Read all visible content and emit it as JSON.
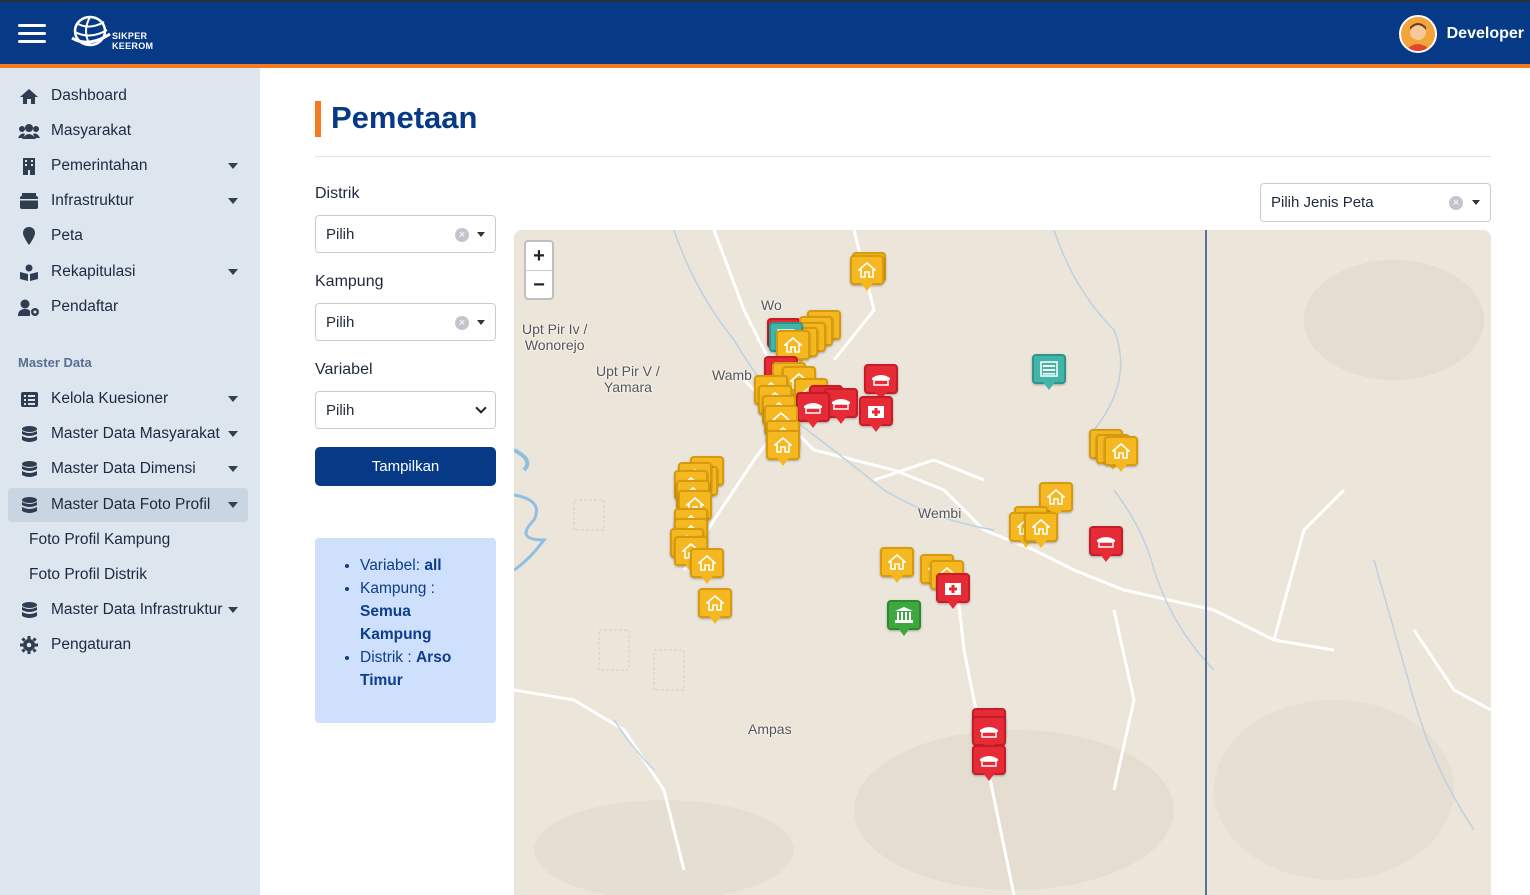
{
  "header": {
    "logo_text_1": "SIKPER",
    "logo_text_2": "KEEROM",
    "user_name": "Developer"
  },
  "sidebar": {
    "items": [
      {
        "label": "Dashboard",
        "icon": "home-icon"
      },
      {
        "label": "Masyarakat",
        "icon": "users-icon"
      },
      {
        "label": "Pemerintahan",
        "icon": "building-icon",
        "has_caret": true
      },
      {
        "label": "Infrastruktur",
        "icon": "box-icon",
        "has_caret": true
      },
      {
        "label": "Peta",
        "icon": "map-marker-icon"
      },
      {
        "label": "Rekapitulasi",
        "icon": "book-reader-icon",
        "has_caret": true
      },
      {
        "label": "Pendaftar",
        "icon": "user-cog-icon"
      }
    ],
    "section_title": "Master Data",
    "master_items": [
      {
        "label": "Kelola Kuesioner",
        "icon": "list-icon",
        "has_caret": true
      },
      {
        "label": "Master Data Masyarakat",
        "icon": "database-icon",
        "has_caret": true
      },
      {
        "label": "Master Data Dimensi",
        "icon": "database-icon",
        "has_caret": true
      },
      {
        "label": "Master Data Foto Profil",
        "icon": "database-icon",
        "has_caret": true,
        "active": true
      },
      {
        "label": "Master Data Infrastruktur",
        "icon": "database-icon",
        "has_caret": true
      },
      {
        "label": "Pengaturan",
        "icon": "gear-icon"
      }
    ],
    "sub_items": [
      "Foto Profil Kampung",
      "Foto Profil Distrik"
    ]
  },
  "main": {
    "title": "Pemetaan",
    "filters": {
      "distrik_label": "Distrik",
      "distrik_value": "Pilih",
      "kampung_label": "Kampung",
      "kampung_value": "Pilih",
      "variabel_label": "Variabel",
      "variabel_value": "Pilih",
      "submit_label": "Tampilkan"
    },
    "map_type_placeholder": "Pilih Jenis Peta",
    "info": {
      "variabel_label": "Variabel:",
      "variabel_value": "all",
      "kampung_label": "Kampung :",
      "kampung_value": "Semua Kampung",
      "distrik_label": "Distrik :",
      "distrik_value": "Arso Timur"
    }
  },
  "map": {
    "zoom_in": "+",
    "zoom_out": "−",
    "places": {
      "p1_a": "Upt Pir Iv /",
      "p1_b": "Wonorejo",
      "p2_a": "Upt Pir V /",
      "p2_b": "Yamara",
      "p3": "Wamb",
      "p4": "Wo",
      "p5": "Wembi",
      "p6": "Ampas"
    },
    "colors": {
      "house": "#f5b821",
      "school": "#e62b37",
      "government": "#3ea83e",
      "other": "#41b6a8"
    }
  }
}
